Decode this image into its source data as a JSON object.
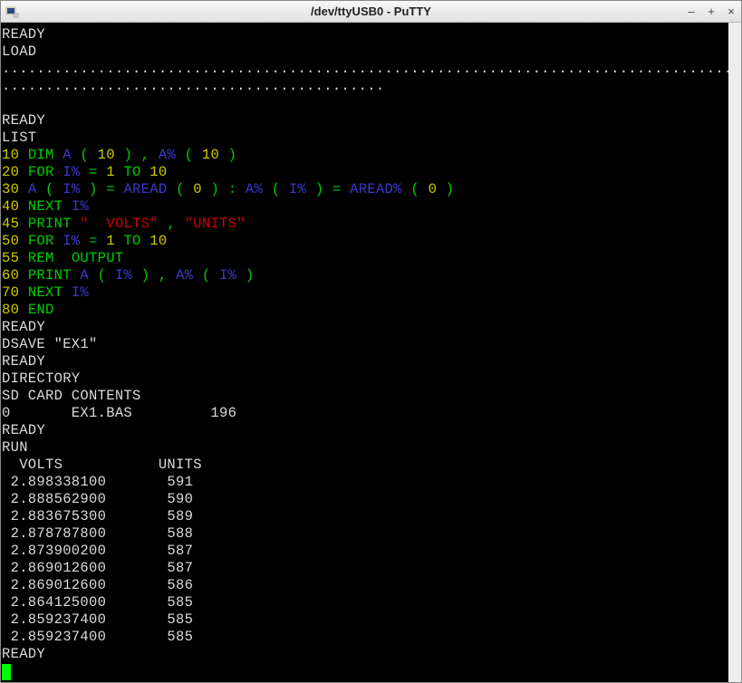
{
  "window": {
    "title": "/dev/ttyUSB0 - PuTTY"
  },
  "terminal": {
    "lines": [
      [
        [
          "w",
          "READY"
        ]
      ],
      [
        [
          "w",
          "LOAD"
        ]
      ],
      [
        [
          "w",
          "...................................................................................................."
        ]
      ],
      [
        [
          "w",
          "............................................"
        ]
      ],
      [],
      [
        [
          "w",
          "READY"
        ]
      ],
      [
        [
          "w",
          "LIST"
        ]
      ],
      [
        [
          "y",
          "10 "
        ],
        [
          "g",
          "DIM "
        ],
        [
          "b",
          "A"
        ],
        [
          "g",
          " ( "
        ],
        [
          "y",
          "10"
        ],
        [
          "g",
          " ) , "
        ],
        [
          "b",
          "A%"
        ],
        [
          "g",
          " ( "
        ],
        [
          "y",
          "10"
        ],
        [
          "g",
          " )"
        ]
      ],
      [
        [
          "y",
          "20 "
        ],
        [
          "g",
          "FOR "
        ],
        [
          "b",
          "I%"
        ],
        [
          "g",
          " = "
        ],
        [
          "y",
          "1"
        ],
        [
          "g",
          " TO "
        ],
        [
          "y",
          "10"
        ]
      ],
      [
        [
          "y",
          "30 "
        ],
        [
          "b",
          "A"
        ],
        [
          "g",
          " ( "
        ],
        [
          "b",
          "I%"
        ],
        [
          "g",
          " ) = "
        ],
        [
          "b",
          "AREAD"
        ],
        [
          "g",
          " ( "
        ],
        [
          "y",
          "0"
        ],
        [
          "g",
          " ) : "
        ],
        [
          "b",
          "A%"
        ],
        [
          "g",
          " ( "
        ],
        [
          "b",
          "I%"
        ],
        [
          "g",
          " ) = "
        ],
        [
          "b",
          "AREAD%"
        ],
        [
          "g",
          " ( "
        ],
        [
          "y",
          "0"
        ],
        [
          "g",
          " )"
        ]
      ],
      [
        [
          "y",
          "40 "
        ],
        [
          "g",
          "NEXT "
        ],
        [
          "b",
          "I%"
        ]
      ],
      [
        [
          "y",
          "45 "
        ],
        [
          "g",
          "PRINT "
        ],
        [
          "r",
          "\"  VOLTS\""
        ],
        [
          "g",
          " , "
        ],
        [
          "r",
          "\"UNITS\""
        ]
      ],
      [
        [
          "y",
          "50 "
        ],
        [
          "g",
          "FOR "
        ],
        [
          "b",
          "I%"
        ],
        [
          "g",
          " = "
        ],
        [
          "y",
          "1"
        ],
        [
          "g",
          " TO "
        ],
        [
          "y",
          "10"
        ]
      ],
      [
        [
          "y",
          "55 "
        ],
        [
          "g",
          "REM  OUTPUT"
        ]
      ],
      [
        [
          "y",
          "60 "
        ],
        [
          "g",
          "PRINT "
        ],
        [
          "b",
          "A"
        ],
        [
          "g",
          " ( "
        ],
        [
          "b",
          "I%"
        ],
        [
          "g",
          " ) , "
        ],
        [
          "b",
          "A%"
        ],
        [
          "g",
          " ( "
        ],
        [
          "b",
          "I%"
        ],
        [
          "g",
          " )"
        ]
      ],
      [
        [
          "y",
          "70 "
        ],
        [
          "g",
          "NEXT "
        ],
        [
          "b",
          "I%"
        ]
      ],
      [
        [
          "y",
          "80 "
        ],
        [
          "g",
          "END"
        ]
      ],
      [
        [
          "w",
          "READY"
        ]
      ],
      [
        [
          "w",
          "DSAVE \"EX1\""
        ]
      ],
      [
        [
          "w",
          "READY"
        ]
      ],
      [
        [
          "w",
          "DIRECTORY"
        ]
      ],
      [
        [
          "w",
          "SD CARD CONTENTS"
        ]
      ],
      [
        [
          "w",
          "0       EX1.BAS         196"
        ]
      ],
      [
        [
          "w",
          "READY"
        ]
      ],
      [
        [
          "w",
          "RUN"
        ]
      ],
      [
        [
          "w",
          "  VOLTS           UNITS"
        ]
      ],
      [
        [
          "w",
          " 2.898338100       591"
        ]
      ],
      [
        [
          "w",
          " 2.888562900       590"
        ]
      ],
      [
        [
          "w",
          " 2.883675300       589"
        ]
      ],
      [
        [
          "w",
          " 2.878787800       588"
        ]
      ],
      [
        [
          "w",
          " 2.873900200       587"
        ]
      ],
      [
        [
          "w",
          " 2.869012600       587"
        ]
      ],
      [
        [
          "w",
          " 2.869012600       586"
        ]
      ],
      [
        [
          "w",
          " 2.864125000       585"
        ]
      ],
      [
        [
          "w",
          " 2.859237400       585"
        ]
      ],
      [
        [
          "w",
          " 2.859237400       585"
        ]
      ],
      [
        [
          "w",
          "READY"
        ]
      ]
    ]
  }
}
